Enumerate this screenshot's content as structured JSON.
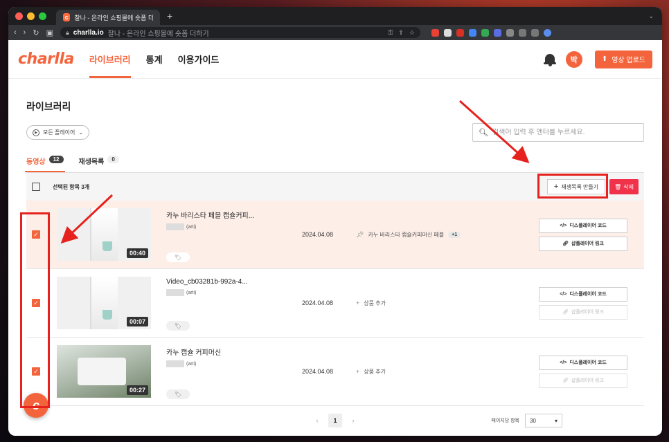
{
  "browser": {
    "tab_title": "찰나 - 온라인 쇼핑몰에 숏폼 더하기",
    "new_tab": "+",
    "url_host": "charlla.io",
    "url_path": "찰나 - 온라인 쇼핑몰에 숏폼 더하기"
  },
  "header": {
    "logo": "charlla",
    "nav": [
      "라이브러리",
      "통계",
      "이용가이드"
    ],
    "avatar": "박",
    "upload_label": "영상 업로드"
  },
  "page": {
    "title": "라이브러리",
    "player_filter": "모든 플레이어",
    "search_placeholder": "검색어 입력 후 엔터를 누르세요.",
    "tabs": [
      {
        "label": "동영상",
        "count": "12"
      },
      {
        "label": "재생목록",
        "count": "0"
      }
    ],
    "selected_label": "선택된 항목 3개",
    "create_playlist_label": "재생목록 만들기",
    "delete_label": "삭제"
  },
  "videos": [
    {
      "title": "카누 바리스타 페블 캡슐커피...",
      "owner": "(arti)",
      "duration": "00:40",
      "date": "2024.04.08",
      "product": "카누 바리스타 캡슐커피머신 페블",
      "more": "+1",
      "display_code": "디스플레이어 코드",
      "shop_link": "샵플레이어 링크"
    },
    {
      "title": "Video_cb03281b-992a-4...",
      "owner": "(arti)",
      "duration": "00:07",
      "date": "2024.04.08",
      "product": "상품 추가",
      "display_code": "디스플레이어 코드",
      "shop_link": "샵플레이어 링크"
    },
    {
      "title": "카누 캡슐 커피머신",
      "owner": "(arti)",
      "duration": "00:27",
      "date": "2024.04.08",
      "product": "상품 추가",
      "display_code": "디스플레이어 코드",
      "shop_link": "샵플레이어 링크"
    }
  ],
  "pagination": {
    "prev": "‹",
    "current": "1",
    "next": "›",
    "per_page_label": "페이지당 항목",
    "per_page_value": "30"
  },
  "colors": {
    "brand": "#f4643c",
    "danger": "#f0334b",
    "annotation": "#e5221d"
  }
}
